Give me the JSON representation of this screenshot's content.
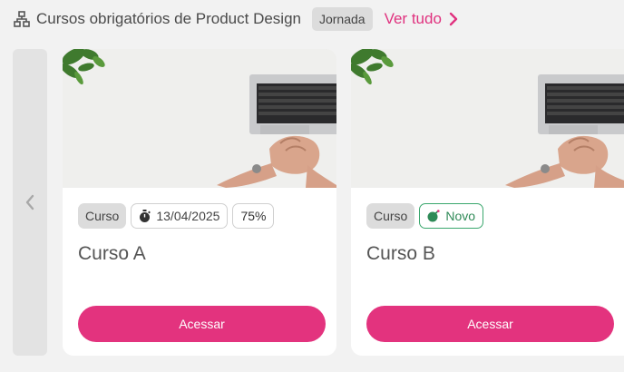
{
  "header": {
    "icon": "sitemap-icon",
    "title": "Cursos obrigatórios de Product Design",
    "badge": "Jornada",
    "link_label": "Ver tudo",
    "link_icon": "chevron-right-icon"
  },
  "carousel": {
    "prev_icon": "chevron-left-icon"
  },
  "cards": [
    {
      "type_tag": "Curso",
      "date_icon": "stopwatch-icon",
      "date": "13/04/2025",
      "progress": "75%",
      "title": "Curso A",
      "button_label": "Acessar"
    },
    {
      "type_tag": "Curso",
      "new_icon": "bomb-icon",
      "new_label": "Novo",
      "title": "Curso B",
      "button_label": "Acessar"
    }
  ],
  "colors": {
    "accent": "#e3337e",
    "link": "#e0327f",
    "new_tag": "#3aa76d",
    "background": "#f2f2f2"
  }
}
